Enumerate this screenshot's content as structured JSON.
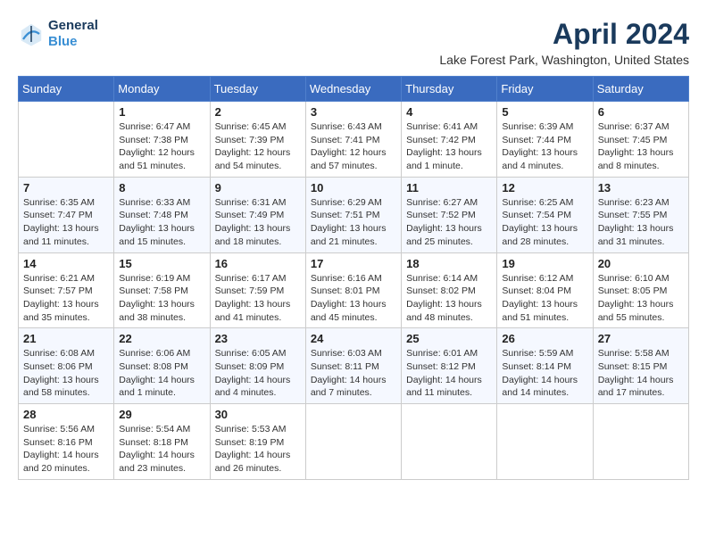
{
  "header": {
    "logo_line1": "General",
    "logo_line2": "Blue",
    "month": "April 2024",
    "location": "Lake Forest Park, Washington, United States"
  },
  "weekdays": [
    "Sunday",
    "Monday",
    "Tuesday",
    "Wednesday",
    "Thursday",
    "Friday",
    "Saturday"
  ],
  "weeks": [
    [
      {
        "day": "",
        "info": ""
      },
      {
        "day": "1",
        "info": "Sunrise: 6:47 AM\nSunset: 7:38 PM\nDaylight: 12 hours\nand 51 minutes."
      },
      {
        "day": "2",
        "info": "Sunrise: 6:45 AM\nSunset: 7:39 PM\nDaylight: 12 hours\nand 54 minutes."
      },
      {
        "day": "3",
        "info": "Sunrise: 6:43 AM\nSunset: 7:41 PM\nDaylight: 12 hours\nand 57 minutes."
      },
      {
        "day": "4",
        "info": "Sunrise: 6:41 AM\nSunset: 7:42 PM\nDaylight: 13 hours\nand 1 minute."
      },
      {
        "day": "5",
        "info": "Sunrise: 6:39 AM\nSunset: 7:44 PM\nDaylight: 13 hours\nand 4 minutes."
      },
      {
        "day": "6",
        "info": "Sunrise: 6:37 AM\nSunset: 7:45 PM\nDaylight: 13 hours\nand 8 minutes."
      }
    ],
    [
      {
        "day": "7",
        "info": "Sunrise: 6:35 AM\nSunset: 7:47 PM\nDaylight: 13 hours\nand 11 minutes."
      },
      {
        "day": "8",
        "info": "Sunrise: 6:33 AM\nSunset: 7:48 PM\nDaylight: 13 hours\nand 15 minutes."
      },
      {
        "day": "9",
        "info": "Sunrise: 6:31 AM\nSunset: 7:49 PM\nDaylight: 13 hours\nand 18 minutes."
      },
      {
        "day": "10",
        "info": "Sunrise: 6:29 AM\nSunset: 7:51 PM\nDaylight: 13 hours\nand 21 minutes."
      },
      {
        "day": "11",
        "info": "Sunrise: 6:27 AM\nSunset: 7:52 PM\nDaylight: 13 hours\nand 25 minutes."
      },
      {
        "day": "12",
        "info": "Sunrise: 6:25 AM\nSunset: 7:54 PM\nDaylight: 13 hours\nand 28 minutes."
      },
      {
        "day": "13",
        "info": "Sunrise: 6:23 AM\nSunset: 7:55 PM\nDaylight: 13 hours\nand 31 minutes."
      }
    ],
    [
      {
        "day": "14",
        "info": "Sunrise: 6:21 AM\nSunset: 7:57 PM\nDaylight: 13 hours\nand 35 minutes."
      },
      {
        "day": "15",
        "info": "Sunrise: 6:19 AM\nSunset: 7:58 PM\nDaylight: 13 hours\nand 38 minutes."
      },
      {
        "day": "16",
        "info": "Sunrise: 6:17 AM\nSunset: 7:59 PM\nDaylight: 13 hours\nand 41 minutes."
      },
      {
        "day": "17",
        "info": "Sunrise: 6:16 AM\nSunset: 8:01 PM\nDaylight: 13 hours\nand 45 minutes."
      },
      {
        "day": "18",
        "info": "Sunrise: 6:14 AM\nSunset: 8:02 PM\nDaylight: 13 hours\nand 48 minutes."
      },
      {
        "day": "19",
        "info": "Sunrise: 6:12 AM\nSunset: 8:04 PM\nDaylight: 13 hours\nand 51 minutes."
      },
      {
        "day": "20",
        "info": "Sunrise: 6:10 AM\nSunset: 8:05 PM\nDaylight: 13 hours\nand 55 minutes."
      }
    ],
    [
      {
        "day": "21",
        "info": "Sunrise: 6:08 AM\nSunset: 8:06 PM\nDaylight: 13 hours\nand 58 minutes."
      },
      {
        "day": "22",
        "info": "Sunrise: 6:06 AM\nSunset: 8:08 PM\nDaylight: 14 hours\nand 1 minute."
      },
      {
        "day": "23",
        "info": "Sunrise: 6:05 AM\nSunset: 8:09 PM\nDaylight: 14 hours\nand 4 minutes."
      },
      {
        "day": "24",
        "info": "Sunrise: 6:03 AM\nSunset: 8:11 PM\nDaylight: 14 hours\nand 7 minutes."
      },
      {
        "day": "25",
        "info": "Sunrise: 6:01 AM\nSunset: 8:12 PM\nDaylight: 14 hours\nand 11 minutes."
      },
      {
        "day": "26",
        "info": "Sunrise: 5:59 AM\nSunset: 8:14 PM\nDaylight: 14 hours\nand 14 minutes."
      },
      {
        "day": "27",
        "info": "Sunrise: 5:58 AM\nSunset: 8:15 PM\nDaylight: 14 hours\nand 17 minutes."
      }
    ],
    [
      {
        "day": "28",
        "info": "Sunrise: 5:56 AM\nSunset: 8:16 PM\nDaylight: 14 hours\nand 20 minutes."
      },
      {
        "day": "29",
        "info": "Sunrise: 5:54 AM\nSunset: 8:18 PM\nDaylight: 14 hours\nand 23 minutes."
      },
      {
        "day": "30",
        "info": "Sunrise: 5:53 AM\nSunset: 8:19 PM\nDaylight: 14 hours\nand 26 minutes."
      },
      {
        "day": "",
        "info": ""
      },
      {
        "day": "",
        "info": ""
      },
      {
        "day": "",
        "info": ""
      },
      {
        "day": "",
        "info": ""
      }
    ]
  ]
}
